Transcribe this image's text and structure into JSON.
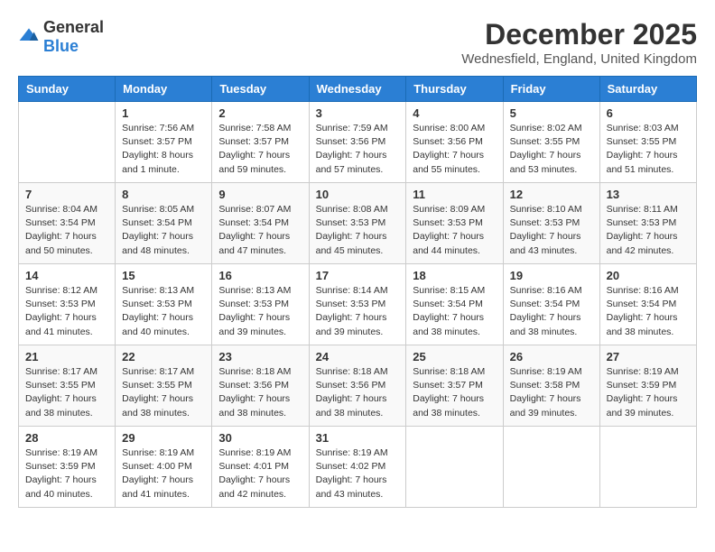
{
  "logo": {
    "text_general": "General",
    "text_blue": "Blue"
  },
  "header": {
    "month_title": "December 2025",
    "location": "Wednesfield, England, United Kingdom"
  },
  "weekdays": [
    "Sunday",
    "Monday",
    "Tuesday",
    "Wednesday",
    "Thursday",
    "Friday",
    "Saturday"
  ],
  "weeks": [
    [
      {
        "day": "",
        "info": ""
      },
      {
        "day": "1",
        "info": "Sunrise: 7:56 AM\nSunset: 3:57 PM\nDaylight: 8 hours\nand 1 minute."
      },
      {
        "day": "2",
        "info": "Sunrise: 7:58 AM\nSunset: 3:57 PM\nDaylight: 7 hours\nand 59 minutes."
      },
      {
        "day": "3",
        "info": "Sunrise: 7:59 AM\nSunset: 3:56 PM\nDaylight: 7 hours\nand 57 minutes."
      },
      {
        "day": "4",
        "info": "Sunrise: 8:00 AM\nSunset: 3:56 PM\nDaylight: 7 hours\nand 55 minutes."
      },
      {
        "day": "5",
        "info": "Sunrise: 8:02 AM\nSunset: 3:55 PM\nDaylight: 7 hours\nand 53 minutes."
      },
      {
        "day": "6",
        "info": "Sunrise: 8:03 AM\nSunset: 3:55 PM\nDaylight: 7 hours\nand 51 minutes."
      }
    ],
    [
      {
        "day": "7",
        "info": "Sunrise: 8:04 AM\nSunset: 3:54 PM\nDaylight: 7 hours\nand 50 minutes."
      },
      {
        "day": "8",
        "info": "Sunrise: 8:05 AM\nSunset: 3:54 PM\nDaylight: 7 hours\nand 48 minutes."
      },
      {
        "day": "9",
        "info": "Sunrise: 8:07 AM\nSunset: 3:54 PM\nDaylight: 7 hours\nand 47 minutes."
      },
      {
        "day": "10",
        "info": "Sunrise: 8:08 AM\nSunset: 3:53 PM\nDaylight: 7 hours\nand 45 minutes."
      },
      {
        "day": "11",
        "info": "Sunrise: 8:09 AM\nSunset: 3:53 PM\nDaylight: 7 hours\nand 44 minutes."
      },
      {
        "day": "12",
        "info": "Sunrise: 8:10 AM\nSunset: 3:53 PM\nDaylight: 7 hours\nand 43 minutes."
      },
      {
        "day": "13",
        "info": "Sunrise: 8:11 AM\nSunset: 3:53 PM\nDaylight: 7 hours\nand 42 minutes."
      }
    ],
    [
      {
        "day": "14",
        "info": "Sunrise: 8:12 AM\nSunset: 3:53 PM\nDaylight: 7 hours\nand 41 minutes."
      },
      {
        "day": "15",
        "info": "Sunrise: 8:13 AM\nSunset: 3:53 PM\nDaylight: 7 hours\nand 40 minutes."
      },
      {
        "day": "16",
        "info": "Sunrise: 8:13 AM\nSunset: 3:53 PM\nDaylight: 7 hours\nand 39 minutes."
      },
      {
        "day": "17",
        "info": "Sunrise: 8:14 AM\nSunset: 3:53 PM\nDaylight: 7 hours\nand 39 minutes."
      },
      {
        "day": "18",
        "info": "Sunrise: 8:15 AM\nSunset: 3:54 PM\nDaylight: 7 hours\nand 38 minutes."
      },
      {
        "day": "19",
        "info": "Sunrise: 8:16 AM\nSunset: 3:54 PM\nDaylight: 7 hours\nand 38 minutes."
      },
      {
        "day": "20",
        "info": "Sunrise: 8:16 AM\nSunset: 3:54 PM\nDaylight: 7 hours\nand 38 minutes."
      }
    ],
    [
      {
        "day": "21",
        "info": "Sunrise: 8:17 AM\nSunset: 3:55 PM\nDaylight: 7 hours\nand 38 minutes."
      },
      {
        "day": "22",
        "info": "Sunrise: 8:17 AM\nSunset: 3:55 PM\nDaylight: 7 hours\nand 38 minutes."
      },
      {
        "day": "23",
        "info": "Sunrise: 8:18 AM\nSunset: 3:56 PM\nDaylight: 7 hours\nand 38 minutes."
      },
      {
        "day": "24",
        "info": "Sunrise: 8:18 AM\nSunset: 3:56 PM\nDaylight: 7 hours\nand 38 minutes."
      },
      {
        "day": "25",
        "info": "Sunrise: 8:18 AM\nSunset: 3:57 PM\nDaylight: 7 hours\nand 38 minutes."
      },
      {
        "day": "26",
        "info": "Sunrise: 8:19 AM\nSunset: 3:58 PM\nDaylight: 7 hours\nand 39 minutes."
      },
      {
        "day": "27",
        "info": "Sunrise: 8:19 AM\nSunset: 3:59 PM\nDaylight: 7 hours\nand 39 minutes."
      }
    ],
    [
      {
        "day": "28",
        "info": "Sunrise: 8:19 AM\nSunset: 3:59 PM\nDaylight: 7 hours\nand 40 minutes."
      },
      {
        "day": "29",
        "info": "Sunrise: 8:19 AM\nSunset: 4:00 PM\nDaylight: 7 hours\nand 41 minutes."
      },
      {
        "day": "30",
        "info": "Sunrise: 8:19 AM\nSunset: 4:01 PM\nDaylight: 7 hours\nand 42 minutes."
      },
      {
        "day": "31",
        "info": "Sunrise: 8:19 AM\nSunset: 4:02 PM\nDaylight: 7 hours\nand 43 minutes."
      },
      {
        "day": "",
        "info": ""
      },
      {
        "day": "",
        "info": ""
      },
      {
        "day": "",
        "info": ""
      }
    ]
  ]
}
